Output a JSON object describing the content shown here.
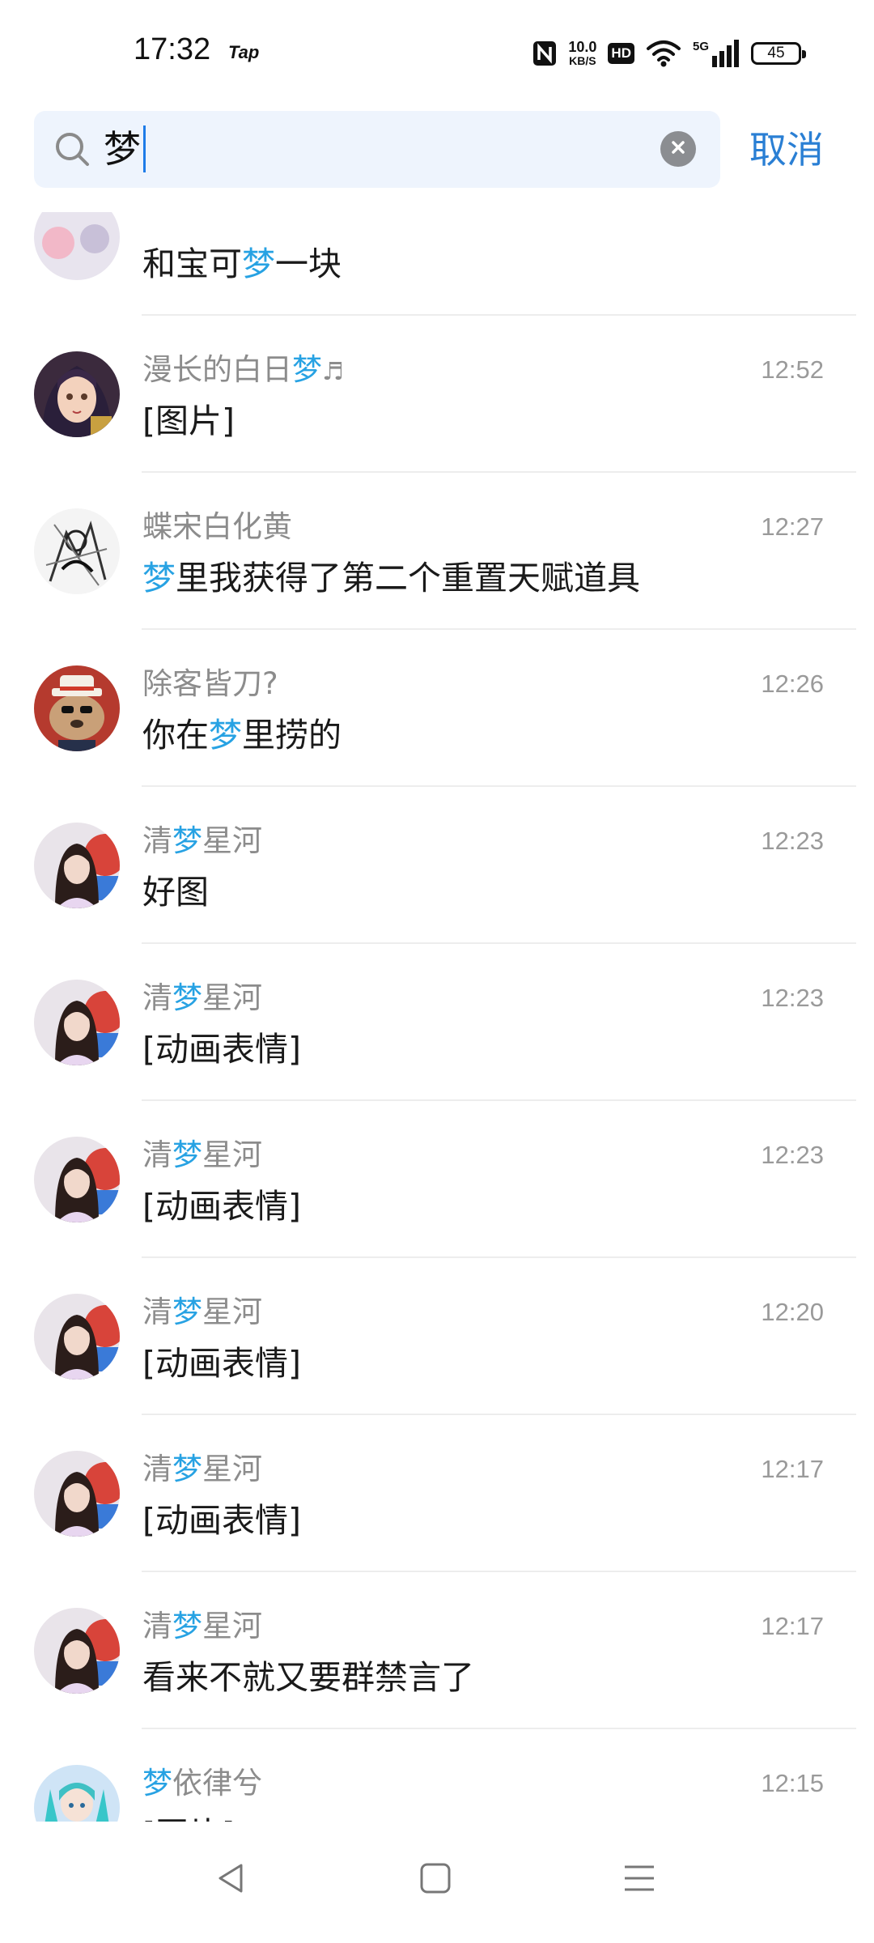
{
  "status_bar": {
    "time": "17:32",
    "app_badge": "Tap",
    "net_speed_value": "10.0",
    "net_speed_unit": "KB/S",
    "hd_label": "HD",
    "net_type": "5G",
    "battery": "45"
  },
  "search": {
    "query": "梦",
    "cancel_label": "取消"
  },
  "results": [
    {
      "name_pre": "",
      "name_hl": "",
      "name_post": "",
      "name_note": "",
      "time": "",
      "msg_pre": "和宝可",
      "msg_hl": "梦",
      "msg_post": "一块",
      "avatar": "partial"
    },
    {
      "name_pre": "漫长的白日",
      "name_hl": "梦",
      "name_post": "",
      "name_note": "♬",
      "time": "12:52",
      "msg_pre": "[图片]",
      "msg_hl": "",
      "msg_post": "",
      "avatar": "anime-girl"
    },
    {
      "name_pre": "蝶宋白化黄",
      "name_hl": "",
      "name_post": "",
      "name_note": "",
      "time": "12:27",
      "msg_pre": "",
      "msg_hl": "梦",
      "msg_post": "里我获得了第二个重置天赋道具",
      "avatar": "sketch"
    },
    {
      "name_pre": "除客皆刀?",
      "name_hl": "",
      "name_post": "",
      "name_note": "",
      "time": "12:26",
      "msg_pre": "你在",
      "msg_hl": "梦",
      "msg_post": "里捞的",
      "avatar": "bear"
    },
    {
      "name_pre": "清",
      "name_hl": "梦",
      "name_post": "星河",
      "name_note": "",
      "time": "12:23",
      "msg_pre": "好图",
      "msg_hl": "",
      "msg_post": "",
      "avatar": "portrait"
    },
    {
      "name_pre": "清",
      "name_hl": "梦",
      "name_post": "星河",
      "name_note": "",
      "time": "12:23",
      "msg_pre": "[动画表情]",
      "msg_hl": "",
      "msg_post": "",
      "avatar": "portrait"
    },
    {
      "name_pre": "清",
      "name_hl": "梦",
      "name_post": "星河",
      "name_note": "",
      "time": "12:23",
      "msg_pre": "[动画表情]",
      "msg_hl": "",
      "msg_post": "",
      "avatar": "portrait"
    },
    {
      "name_pre": "清",
      "name_hl": "梦",
      "name_post": "星河",
      "name_note": "",
      "time": "12:20",
      "msg_pre": "[动画表情]",
      "msg_hl": "",
      "msg_post": "",
      "avatar": "portrait"
    },
    {
      "name_pre": "清",
      "name_hl": "梦",
      "name_post": "星河",
      "name_note": "",
      "time": "12:17",
      "msg_pre": "[动画表情]",
      "msg_hl": "",
      "msg_post": "",
      "avatar": "portrait"
    },
    {
      "name_pre": "清",
      "name_hl": "梦",
      "name_post": "星河",
      "name_note": "",
      "time": "12:17",
      "msg_pre": "看来不就又要群禁言了",
      "msg_hl": "",
      "msg_post": "",
      "avatar": "portrait"
    },
    {
      "name_pre": "",
      "name_hl": "梦",
      "name_post": "依律兮",
      "name_note": "",
      "time": "12:15",
      "msg_pre": "[图片]",
      "msg_hl": "",
      "msg_post": "",
      "avatar": "miku"
    }
  ],
  "colors": {
    "highlight": "#27a2e3",
    "accent": "#2a7fd4",
    "search_bg": "#eef4fd"
  },
  "icons": {
    "search": "search-icon",
    "clear": "clear-icon",
    "nav_back": "back-triangle-icon",
    "nav_home": "home-square-icon",
    "nav_menu": "menu-lines-icon"
  }
}
